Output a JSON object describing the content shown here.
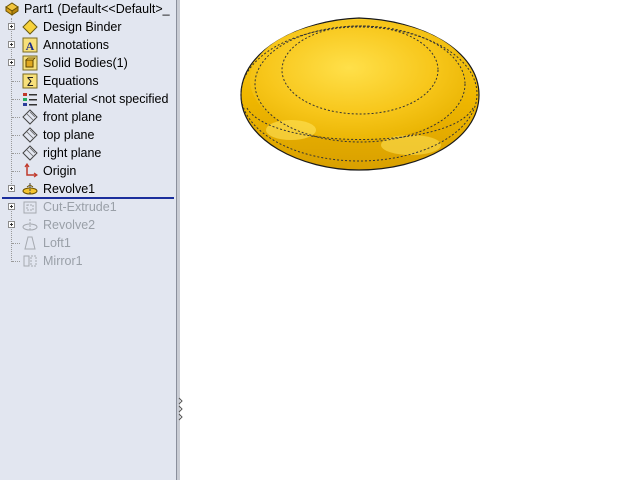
{
  "feature_tree": {
    "root": {
      "label": "Part1  (Default<<Default>_",
      "icon": "part-icon"
    },
    "items": [
      {
        "label": "Design Binder",
        "icon": "design-binder-icon",
        "expandable": true,
        "state": "normal"
      },
      {
        "label": "Annotations",
        "icon": "annotations-icon",
        "expandable": true,
        "state": "normal"
      },
      {
        "label": "Solid Bodies(1)",
        "icon": "solid-bodies-icon",
        "expandable": true,
        "state": "normal"
      },
      {
        "label": "Equations",
        "icon": "equations-icon",
        "expandable": false,
        "state": "normal"
      },
      {
        "label": "Material <not specified",
        "icon": "material-icon",
        "expandable": false,
        "state": "normal"
      },
      {
        "label": "front plane",
        "icon": "plane-icon",
        "expandable": false,
        "state": "normal"
      },
      {
        "label": "top plane",
        "icon": "plane-icon",
        "expandable": false,
        "state": "normal"
      },
      {
        "label": "right plane",
        "icon": "plane-icon",
        "expandable": false,
        "state": "normal"
      },
      {
        "label": "Origin",
        "icon": "origin-icon",
        "expandable": false,
        "state": "normal"
      },
      {
        "label": "Revolve1",
        "icon": "revolve-icon",
        "expandable": true,
        "state": "normal"
      },
      {
        "label": "Cut-Extrude1",
        "icon": "cut-extrude-icon",
        "expandable": true,
        "state": "suppressed"
      },
      {
        "label": "Revolve2",
        "icon": "revolve-icon",
        "expandable": true,
        "state": "suppressed"
      },
      {
        "label": "Loft1",
        "icon": "loft-icon",
        "expandable": false,
        "state": "suppressed"
      },
      {
        "label": "Mirror1",
        "icon": "mirror-icon",
        "expandable": false,
        "state": "suppressed"
      }
    ]
  },
  "model": {
    "shape": "revolved-disc",
    "color": "#f5c518",
    "highlight": "#ffe04a",
    "shade": "#d9a400"
  },
  "colors": {
    "panel_bg": "#e2e6f0",
    "rollback_bar": "#1a2e9c",
    "suppressed_text": "#9aa0a8"
  }
}
